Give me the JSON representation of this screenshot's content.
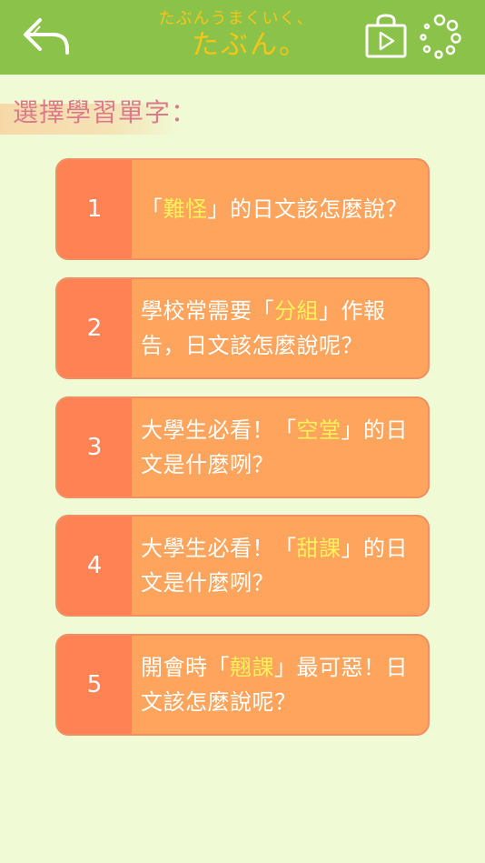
{
  "header": {
    "logo_line1": "たぶんうまくいく、",
    "logo_line2": "たぶん。",
    "colors": {
      "bar": "#8bc34a",
      "logo": "#f5c518"
    },
    "icons": {
      "back": "back-arrow-icon",
      "store": "play-store-bag-icon",
      "loading": "loading-dots-icon"
    }
  },
  "section": {
    "label": "選擇學習單字："
  },
  "items": [
    {
      "num": "1",
      "pre": "「",
      "hl": "難怪",
      "post": "」的日文該怎麼說？"
    },
    {
      "num": "2",
      "pre": "學校常需要「",
      "hl": "分組",
      "post": "」作報告，日文該怎麼說呢？"
    },
    {
      "num": "3",
      "pre": "大學生必看！「",
      "hl": "空堂",
      "post": "」的日文是什麼咧？"
    },
    {
      "num": "4",
      "pre": "大學生必看！「",
      "hl": "甜課",
      "post": "」的日文是什麼咧？"
    },
    {
      "num": "5",
      "pre": "開會時「",
      "hl": "翹課",
      "post": "」最可惡！日文該怎麼說呢？"
    }
  ]
}
